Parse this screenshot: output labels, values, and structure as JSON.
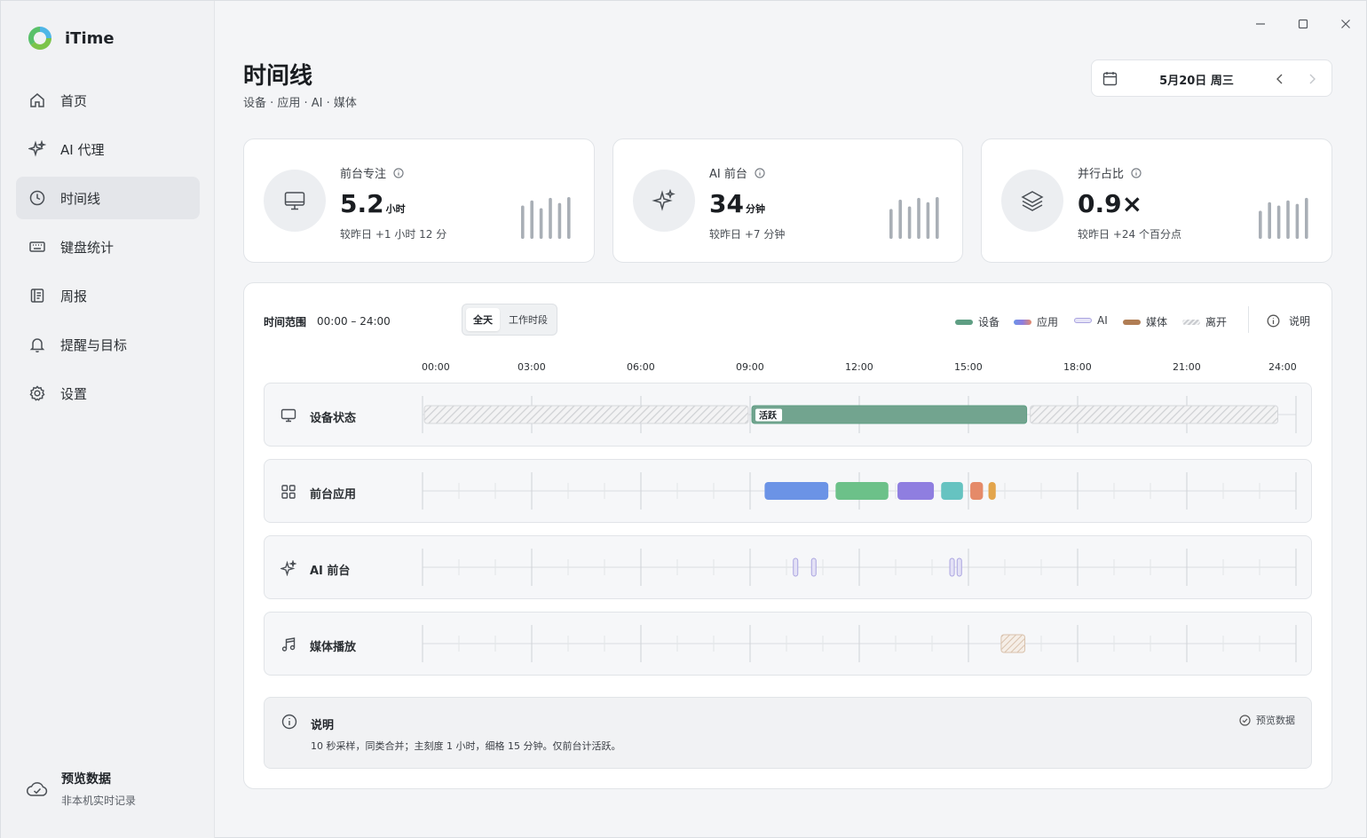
{
  "app": {
    "name": "iTime"
  },
  "sidebar": {
    "items": [
      {
        "label": "首页",
        "icon": "home-icon"
      },
      {
        "label": "AI 代理",
        "icon": "sparkle-icon"
      },
      {
        "label": "时间线",
        "icon": "clock-icon",
        "active": true
      },
      {
        "label": "键盘统计",
        "icon": "keyboard-icon"
      },
      {
        "label": "周报",
        "icon": "report-icon"
      },
      {
        "label": "提醒与目标",
        "icon": "bell-icon"
      },
      {
        "label": "设置",
        "icon": "gear-icon"
      }
    ],
    "footer": {
      "title": "预览数据",
      "subtitle": "非本机实时记录",
      "icon": "cloud-check-icon"
    }
  },
  "header": {
    "title": "时间线",
    "subtitle": "设备 · 应用 · AI · 媒体",
    "date": "5月20日 周三"
  },
  "stats": [
    {
      "label": "前台专注",
      "value": "5.2",
      "unit": "小时",
      "delta": "较昨日 +1 小时 12 分",
      "icon": "monitor-icon",
      "spark": [
        0.78,
        0.9,
        0.72,
        0.96,
        0.84,
        0.98
      ]
    },
    {
      "label": "AI 前台",
      "value": "34",
      "unit": "分钟",
      "delta": "较昨日 +7 分钟",
      "icon": "sparkle-icon",
      "spark": [
        0.7,
        0.92,
        0.76,
        0.96,
        0.86,
        0.98
      ]
    },
    {
      "label": "并行占比",
      "value": "0.9×",
      "unit": "",
      "delta": "较昨日 +24 个百分点",
      "icon": "layers-icon",
      "spark": [
        0.66,
        0.86,
        0.78,
        0.9,
        0.82,
        0.96
      ]
    }
  ],
  "timeline": {
    "range_label": "时间范围",
    "range_value": "00:00 – 24:00",
    "modes": [
      "全天",
      "工作时段"
    ],
    "active_mode": "全天",
    "legend": [
      {
        "label": "设备",
        "color": "#5e9e83"
      },
      {
        "label": "应用",
        "color": "gradient"
      },
      {
        "label": "AI",
        "color": "#c9c5ee"
      },
      {
        "label": "媒体",
        "color": "#b07d54"
      },
      {
        "label": "离开",
        "color": "hatched"
      }
    ],
    "explain_label": "说明",
    "axis_ticks": [
      "00:00",
      "03:00",
      "06:00",
      "09:00",
      "12:00",
      "15:00",
      "18:00",
      "21:00",
      "24:00"
    ],
    "rows": [
      {
        "label": "设备状态",
        "icon": "monitor-icon"
      },
      {
        "label": "前台应用",
        "icon": "grid-icon"
      },
      {
        "label": "AI 前台",
        "icon": "sparkle-icon"
      },
      {
        "label": "媒体播放",
        "icon": "music-icon"
      }
    ],
    "device_segments": [
      {
        "start": 0.05,
        "end": 8.95,
        "kind": "away"
      },
      {
        "start": 9.05,
        "end": 16.6,
        "kind": "active",
        "label": "活跃"
      },
      {
        "start": 16.7,
        "end": 23.5,
        "kind": "away"
      }
    ],
    "app_segments": [
      {
        "start": 9.4,
        "end": 11.15,
        "color": "#6b93e6"
      },
      {
        "start": 11.35,
        "end": 12.8,
        "color": "#6cc189"
      },
      {
        "start": 13.05,
        "end": 14.05,
        "color": "#8f7ee0"
      },
      {
        "start": 14.25,
        "end": 14.85,
        "color": "#66c3c1"
      },
      {
        "start": 15.05,
        "end": 15.4,
        "color": "#e58a69"
      },
      {
        "start": 15.55,
        "end": 15.75,
        "color": "#e3a54c"
      }
    ],
    "ai_marks": [
      10.25,
      10.75,
      14.55,
      14.75
    ],
    "media_segments": [
      {
        "start": 15.9,
        "end": 16.55
      }
    ],
    "note": {
      "title": "说明",
      "text": "10 秒采样，同类合并；主刻度 1 小时，细格 15 分钟。仅前台计活跃。",
      "badge": "预览数据"
    }
  }
}
